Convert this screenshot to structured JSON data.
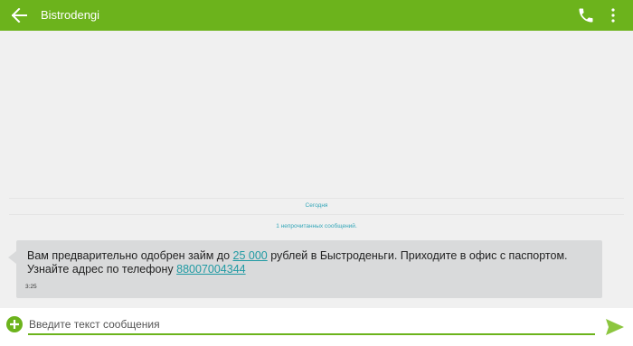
{
  "appbar": {
    "title": "Bistrodengi",
    "icons": {
      "back": "arrow-left-icon",
      "call": "phone-icon",
      "menu": "more-vert-icon"
    },
    "color": "#6cb31c"
  },
  "conversation": {
    "date_divider": "Сегодня",
    "unread_divider": "1 непрочитанных сообщений.",
    "message": {
      "text_before_amount": "Вам предварительно одобрен займ до ",
      "amount_link": "25 000",
      "text_after_amount": " рублей в Быстроденьги. Приходите в офис с паспортом. Узнайте адрес по телефону ",
      "phone_link": "88007004344",
      "time": "3:25"
    }
  },
  "composer": {
    "placeholder": "Введите текст сообщения",
    "value": "",
    "icons": {
      "add": "add-circle-icon",
      "send": "send-icon"
    },
    "accent_color": "#6cb31c",
    "send_color": "#8cc63f"
  }
}
